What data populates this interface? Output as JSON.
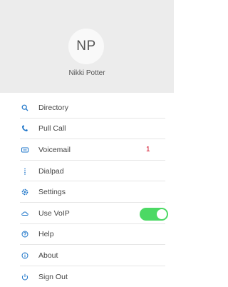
{
  "profile": {
    "initials": "NP",
    "name": "Nikki Potter"
  },
  "menu": {
    "items": [
      {
        "label": "Directory",
        "icon": "search-icon"
      },
      {
        "label": "Pull Call",
        "icon": "phone-transfer-icon"
      },
      {
        "label": "Voicemail",
        "icon": "voicemail-icon",
        "badge": "1"
      },
      {
        "label": "Dialpad",
        "icon": "dialpad-icon"
      },
      {
        "label": "Settings",
        "icon": "gear-icon"
      },
      {
        "label": "Use VoIP",
        "icon": "cloud-icon",
        "toggle": true
      },
      {
        "label": "Help",
        "icon": "help-icon"
      },
      {
        "label": "About",
        "icon": "info-icon"
      },
      {
        "label": "Sign Out",
        "icon": "sign-out-icon"
      }
    ]
  },
  "colors": {
    "accent": "#1a73c8",
    "badge": "#d0021b",
    "toggle_on": "#4cd964",
    "profile_bg": "#ececec"
  }
}
